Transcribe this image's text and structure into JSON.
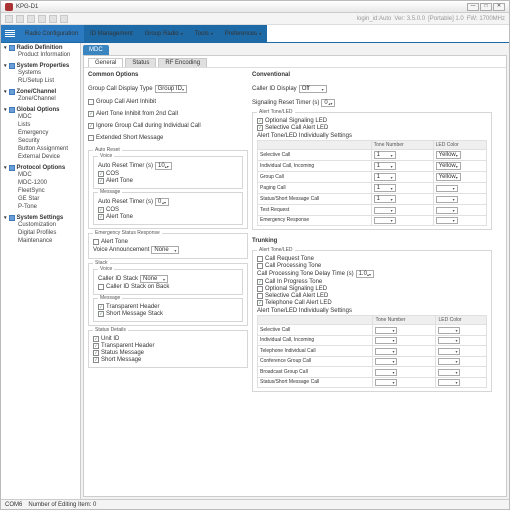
{
  "window": {
    "title": "KPG-D1",
    "title_suffix": "",
    "min": "—",
    "max": "□",
    "close": "✕"
  },
  "ribbon": [
    {
      "label": "Radio Configuration"
    },
    {
      "label": "ID Management"
    },
    {
      "label": "Group Radio",
      "drop": "▾"
    },
    {
      "label": "Tools",
      "drop": "▾"
    },
    {
      "label": "Preferences",
      "drop": "▾"
    }
  ],
  "breadcrumb": [
    "login_id:Auto",
    "Ver: 3.5.0.0",
    "[Portable] 1.0",
    "FW: 1700MHz"
  ],
  "side": [
    {
      "hdr": "Radio Definition",
      "items": [
        "Product Information"
      ]
    },
    {
      "hdr": "System Properties",
      "items": [
        "Systems",
        "RL/Setup List"
      ]
    },
    {
      "hdr": "Zone/Channel",
      "items": [
        "Zone/Channel"
      ]
    },
    {
      "hdr": "Global Options",
      "items": [
        "MDC",
        "Lists",
        "Emergency",
        "Security",
        "Button Assignment",
        "External Device"
      ]
    },
    {
      "hdr": "Protocol Options",
      "items": [
        "MDC",
        "MDC-1200",
        "FleetSync",
        "GE Star",
        "P-Tone"
      ]
    },
    {
      "hdr": "System Settings",
      "items": [
        "Customization",
        "Digital Profiles",
        "Maintenance"
      ]
    }
  ],
  "ctab": "MDC",
  "subtabs": [
    "General",
    "Status",
    "RF Encoding"
  ],
  "c1": {
    "common_hdr": "Common Options",
    "gcdt_lbl": "Group Call Display Type",
    "gcdt_val": "Group ID",
    "gci_lbl": "Group Call Alert Inhibit",
    "atif_lbl": "Alert Tone Inhibit from 2nd Call",
    "igc_lbl": "Ignore Group Call during Individual Call",
    "esm_lbl": "Extended Short Message",
    "ar_hdr": "Auto Reset",
    "ar_voice": "Voice",
    "ar_art": "Auto Reset Timer (s)",
    "ar_art_v": "10",
    "ar_cos": "COS",
    "ar_at": "Alert Tone",
    "ar_msg": "Message",
    "ar_m_art": "Auto Reset Timer (s)",
    "ar_m_art_v": "0",
    "ar_m_cos": "COS",
    "ar_m_at": "Alert Tone",
    "esr_hdr": "Emergency Status Response",
    "esr_lbl": "Alert Tone",
    "esr_vak_lbl": "Voice Announcement",
    "esr_vak_v": "None",
    "stack_hdr": "Stack",
    "stack_voice": "Voice",
    "cidb_lbl": "Caller ID Stack",
    "cidb_v": "None",
    "cid_back": "Caller ID Stack on Back",
    "stack_msg": "Message",
    "sm_ths": "Transparent Header",
    "sm_sms": "Short Message Stack",
    "stat_grp": "Status Details",
    "sg_uid": "Unit ID",
    "sg_th": "Transparent Header",
    "sg_stm": "Status Message",
    "sg_smm": "Short Message"
  },
  "c2": {
    "conv_hdr": "Conventional",
    "cid_disp": "Caller ID Display",
    "cid_disp_v": "Off",
    "srt": "Signaling Reset Timer (s)",
    "srt_v": "0",
    "at_led": "Alert Tone/LED",
    "os_led": "Optional Signaling LED",
    "sc_led": "Selective Call Alert LED",
    "atl_is": "Alert Tone/LED Individually Settings",
    "table1": {
      "cols": [
        "",
        "Tone Number",
        "LED Color"
      ],
      "rows": [
        [
          "Selective Call",
          "1",
          "Yellow"
        ],
        [
          "Individual Call, Incoming",
          "1",
          "Yellow"
        ],
        [
          "Group Call",
          "1",
          "Yellow"
        ],
        [
          "Paging Call",
          "1",
          ""
        ],
        [
          "Status/Short Message Call",
          "1",
          ""
        ],
        [
          "Test Request",
          "",
          ""
        ],
        [
          "Emergency Response",
          "",
          ""
        ]
      ]
    },
    "trk_hdr": "Trunking",
    "trk_at": "Alert Tone/LED",
    "trk_crt": "Call Request Tone",
    "trk_cpt": "Call Processing Tone",
    "trk_cptd": "Call Processing Tone Delay Time (s)",
    "trk_cptd_v": "1.0",
    "trk_cip": "Call In Progress Tone",
    "trk_os": "Optional Signaling LED",
    "trk_sc": "Selective Call Alert LED",
    "trk_tc": "Telephone Call Alert LED",
    "trk_is": "Alert Tone/LED Individually Settings",
    "table2": {
      "cols": [
        "",
        "Tone Number",
        "LED Color"
      ],
      "rows": [
        [
          "Selective Call",
          "",
          ""
        ],
        [
          "Individual Call, Incoming",
          "",
          ""
        ],
        [
          "Telephone Individual Call",
          "",
          ""
        ],
        [
          "Conference Group Call",
          "",
          ""
        ],
        [
          "Broadcast Group Call",
          "",
          ""
        ],
        [
          "Status/Short Message Call",
          "",
          ""
        ]
      ]
    }
  },
  "status": {
    "l": "COM6",
    "r": "Number of Editing Item: 0"
  }
}
